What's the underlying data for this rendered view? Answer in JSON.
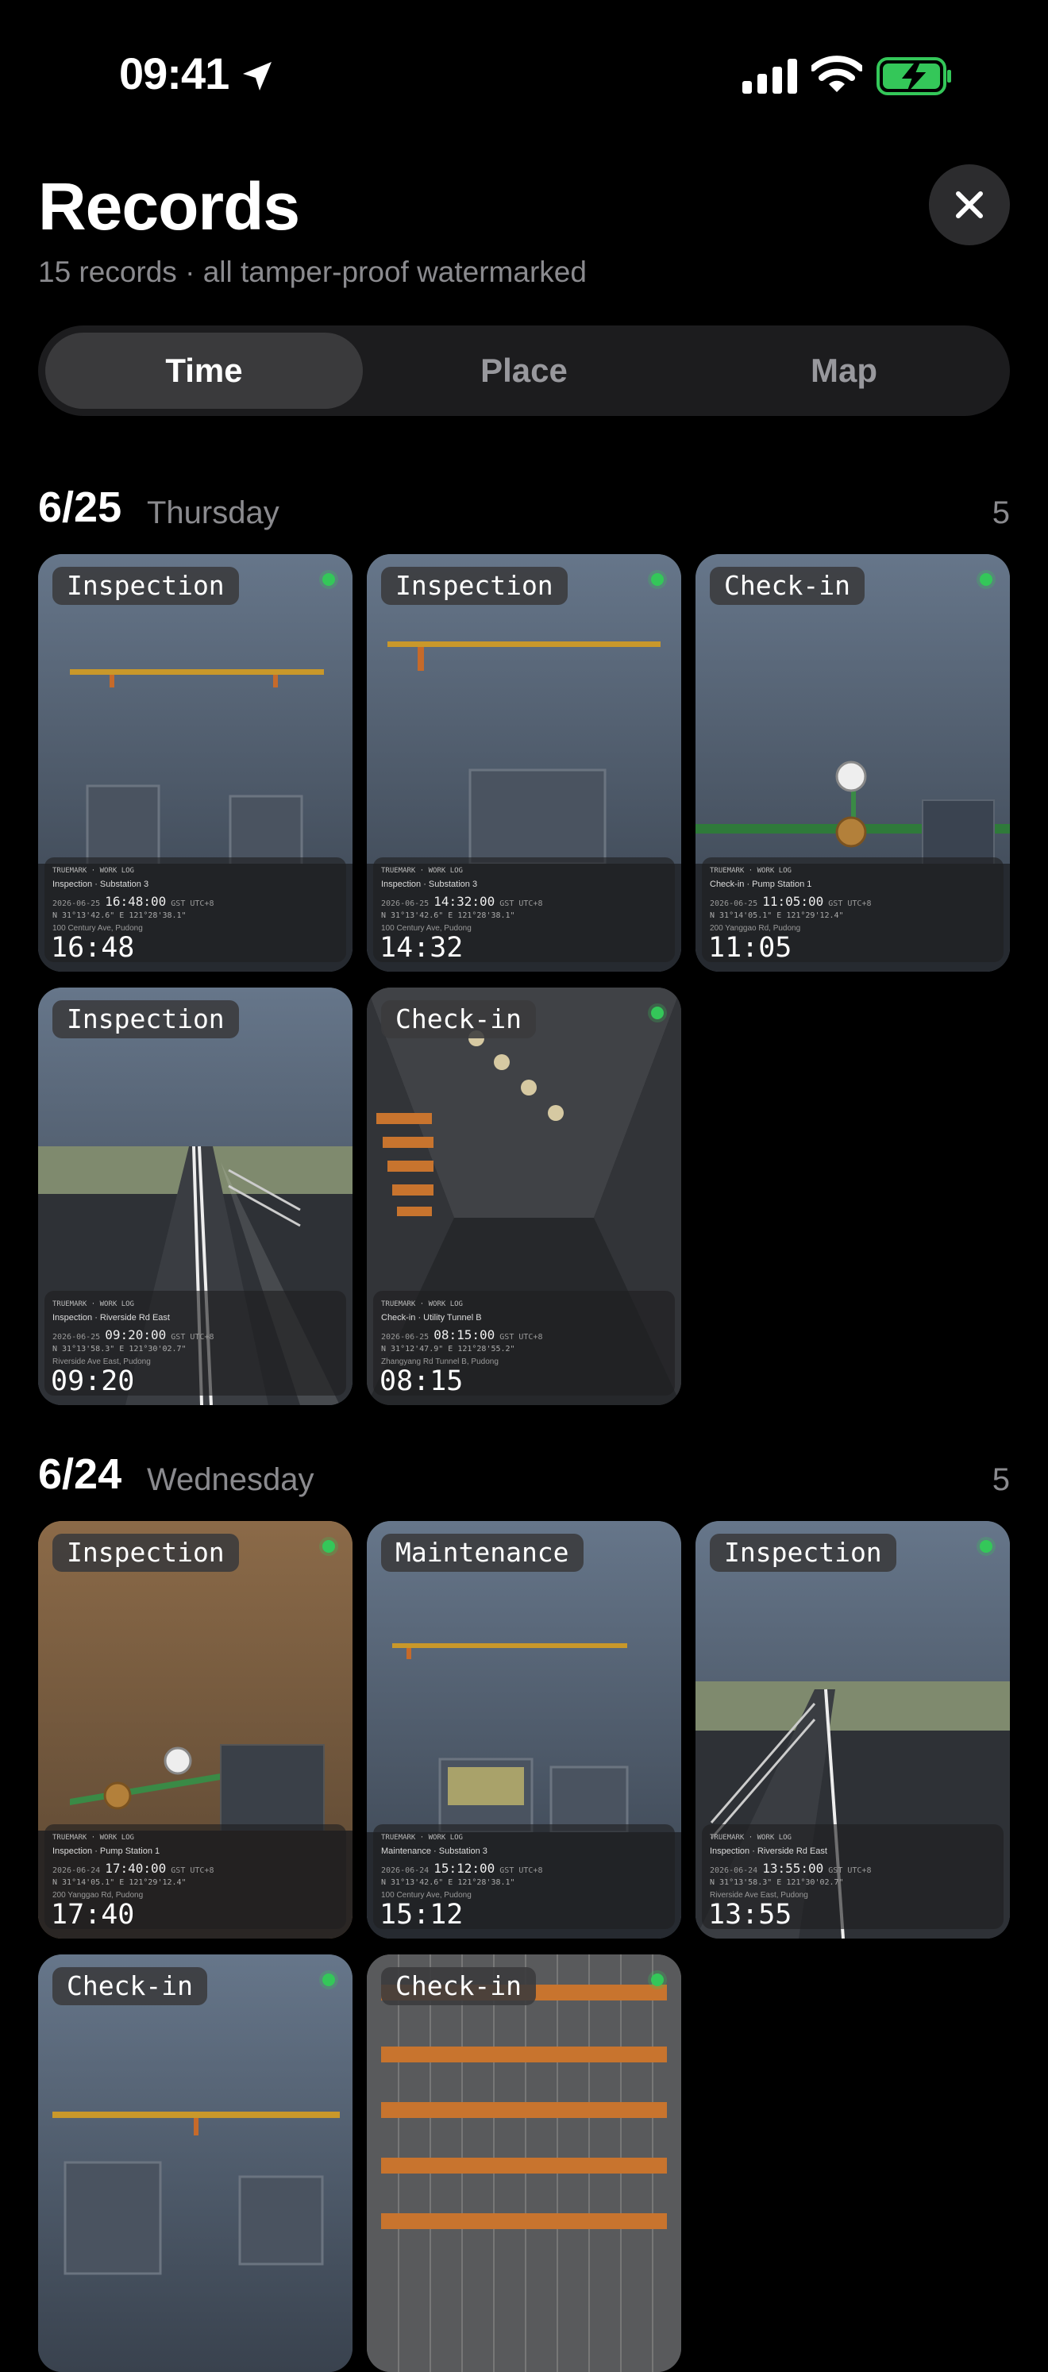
{
  "status": {
    "time": "09:41"
  },
  "header": {
    "title": "Records",
    "subtitle": "15 records · all tamper-proof watermarked"
  },
  "segments": {
    "time": "Time",
    "place": "Place",
    "map": "Map",
    "selected": "Time"
  },
  "watermark_brand": "TRUEMARK · WORK LOG",
  "day1": {
    "date": "6/25",
    "weekday": "Thursday",
    "count": "5",
    "records": [
      {
        "tag": "Inspection",
        "title": "Inspection · Substation 3",
        "date": "2026-06-25",
        "clock": "16:48:00",
        "tz": "GST UTC+8",
        "coords": "N 31°13'42.6\"  E 121°28'38.1\"",
        "address": "100 Century Ave, Pudong",
        "time": "16:48"
      },
      {
        "tag": "Inspection",
        "title": "Inspection · Substation 3",
        "date": "2026-06-25",
        "clock": "14:32:00",
        "tz": "GST UTC+8",
        "coords": "N 31°13'42.6\"  E 121°28'38.1\"",
        "address": "100 Century Ave, Pudong",
        "time": "14:32"
      },
      {
        "tag": "Check-in",
        "title": "Check-in · Pump Station 1",
        "date": "2026-06-25",
        "clock": "11:05:00",
        "tz": "GST UTC+8",
        "coords": "N 31°14'05.1\"  E 121°29'12.4\"",
        "address": "200 Yanggao Rd, Pudong",
        "time": "11:05"
      },
      {
        "tag": "Inspection",
        "title": "Inspection · Riverside Rd East",
        "date": "2026-06-25",
        "clock": "09:20:00",
        "tz": "GST UTC+8",
        "coords": "N 31°13'58.3\"  E 121°30'02.7\"",
        "address": "Riverside Ave East, Pudong",
        "time": "09:20"
      },
      {
        "tag": "Check-in",
        "title": "Check-in · Utility Tunnel B",
        "date": "2026-06-25",
        "clock": "08:15:00",
        "tz": "GST UTC+8",
        "coords": "N 31°12'47.9\"  E 121°28'55.2\"",
        "address": "Zhangyang Rd Tunnel B, Pudong",
        "time": "08:15"
      }
    ]
  },
  "day2": {
    "date": "6/24",
    "weekday": "Wednesday",
    "count": "5",
    "records": [
      {
        "tag": "Inspection",
        "title": "Inspection · Pump Station 1",
        "date": "2026-06-24",
        "clock": "17:40:00",
        "tz": "GST UTC+8",
        "coords": "N 31°14'05.1\"  E 121°29'12.4\"",
        "address": "200 Yanggao Rd, Pudong",
        "time": "17:40"
      },
      {
        "tag": "Maintenance",
        "title": "Maintenance · Substation 3",
        "date": "2026-06-24",
        "clock": "15:12:00",
        "tz": "GST UTC+8",
        "coords": "N 31°13'42.6\"  E 121°28'38.1\"",
        "address": "100 Century Ave, Pudong",
        "time": "15:12"
      },
      {
        "tag": "Inspection",
        "title": "Inspection · Riverside Rd East",
        "date": "2026-06-24",
        "clock": "13:55:00",
        "tz": "GST UTC+8",
        "coords": "N 31°13'58.3\"  E 121°30'02.7\"",
        "address": "Riverside Ave East, Pudong",
        "time": "13:55"
      },
      {
        "tag": "Check-in",
        "title": "",
        "date": "",
        "clock": "",
        "tz": "",
        "coords": "",
        "address": "",
        "time": ""
      },
      {
        "tag": "Check-in",
        "title": "",
        "date": "",
        "clock": "",
        "tz": "",
        "coords": "",
        "address": "",
        "time": ""
      }
    ]
  }
}
